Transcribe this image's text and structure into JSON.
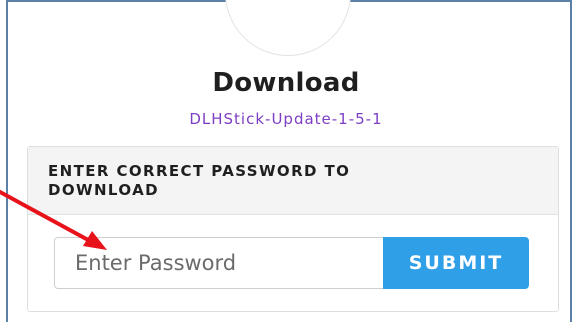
{
  "title": "Download",
  "filename": "DLHStick-Update-1-5-1",
  "card": {
    "header": "ENTER CORRECT PASSWORD TO DOWNLOAD"
  },
  "form": {
    "password_placeholder": "Enter Password",
    "submit_label": "SUBMIT"
  },
  "colors": {
    "accent": "#2f9fe8",
    "filename": "#7d3fc4",
    "annotation_arrow": "#e8121b"
  }
}
